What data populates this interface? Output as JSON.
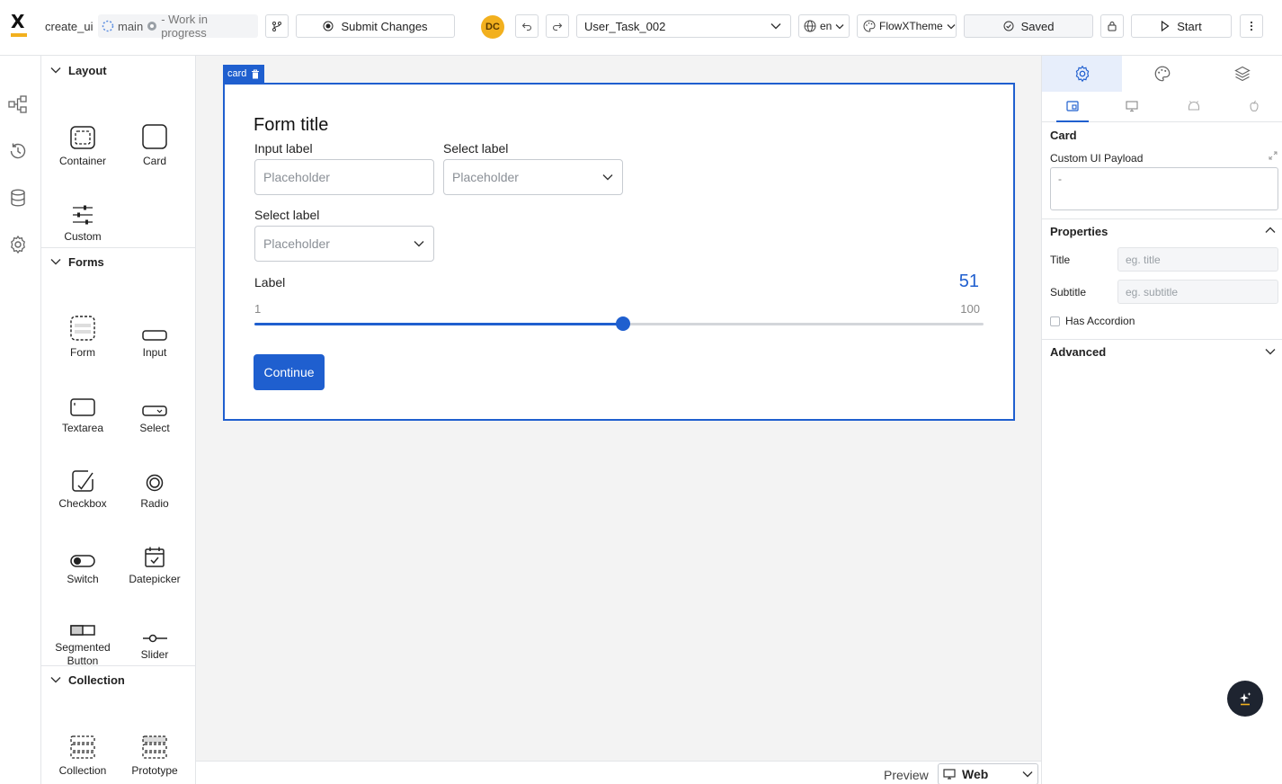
{
  "topbar": {
    "project_name": "create_ui",
    "branch": "main",
    "branch_status": "- Work in progress",
    "submit_label": "Submit Changes",
    "avatar_initials": "DC",
    "task_select": "User_Task_002",
    "language": "en",
    "theme": "FlowXTheme",
    "saved_label": "Saved",
    "start_label": "Start"
  },
  "palette": {
    "sections": {
      "layout": "Layout",
      "forms": "Forms",
      "collection": "Collection"
    },
    "layout_items": [
      "Container",
      "Card",
      "Custom"
    ],
    "form_items": [
      "Form",
      "Input",
      "Textarea",
      "Select",
      "Checkbox",
      "Radio",
      "Switch",
      "Datepicker",
      "Segmented Button",
      "Slider"
    ],
    "collection_items": [
      "Collection",
      "Prototype"
    ]
  },
  "canvas": {
    "card_tag": "card",
    "form_title": "Form title",
    "input_label": "Input label",
    "input_placeholder": "Placeholder",
    "select1_label": "Select label",
    "select1_placeholder": "Placeholder",
    "select2_label": "Select label",
    "select2_placeholder": "Placeholder",
    "slider": {
      "label": "Label",
      "value": 51,
      "min": 1,
      "max": 100
    },
    "continue_label": "Continue"
  },
  "preview": {
    "label": "Preview",
    "mode": "Web"
  },
  "right_panel": {
    "component_name": "Card",
    "payload_label": "Custom UI Payload",
    "payload_value": "-",
    "properties_label": "Properties",
    "title_label": "Title",
    "title_placeholder": "eg. title",
    "subtitle_label": "Subtitle",
    "subtitle_placeholder": "eg. subtitle",
    "accordion_label": "Has Accordion",
    "advanced_label": "Advanced"
  },
  "colors": {
    "accent": "#1f5fcf",
    "brand": "#f2b01e"
  }
}
